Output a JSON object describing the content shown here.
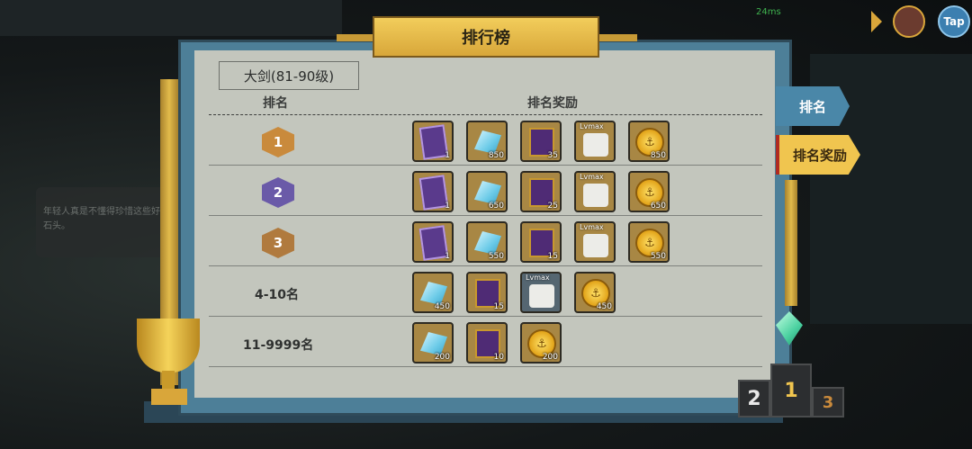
{
  "hud": {
    "ping": "24ms",
    "tap_label": "Tap"
  },
  "npc_bubble": {
    "text": "年轻人真是不懂得珍惜这些好石头。"
  },
  "panel": {
    "title": "排行榜",
    "category": "大剑(81-90级)",
    "col_rank": "排名",
    "col_reward": "排名奖励"
  },
  "tabs": [
    {
      "label": "排名",
      "active": false
    },
    {
      "label": "排名奖励",
      "active": true
    }
  ],
  "rows": [
    {
      "rank": "1",
      "rank_type": "badge",
      "badge_color": "#c98a3c",
      "rewards": [
        {
          "icon": "purple-card-icon",
          "count": "1"
        },
        {
          "icon": "blue-gem-icon",
          "count": "850"
        },
        {
          "icon": "purple-book-icon",
          "count": "35"
        },
        {
          "icon": "lvmax-scroll-icon",
          "label": "Lvmax",
          "count": ""
        },
        {
          "icon": "gold-coin-icon",
          "count": "850"
        }
      ]
    },
    {
      "rank": "2",
      "rank_type": "badge",
      "badge_color": "#6a5aa8",
      "rewards": [
        {
          "icon": "purple-card-icon",
          "count": "1"
        },
        {
          "icon": "blue-gem-icon",
          "count": "650"
        },
        {
          "icon": "purple-book-icon",
          "count": "25"
        },
        {
          "icon": "lvmax-scroll-icon",
          "label": "Lvmax",
          "count": ""
        },
        {
          "icon": "gold-coin-icon",
          "count": "650"
        }
      ]
    },
    {
      "rank": "3",
      "rank_type": "badge",
      "badge_color": "#b07a3e",
      "rewards": [
        {
          "icon": "purple-card-icon",
          "count": "1"
        },
        {
          "icon": "blue-gem-icon",
          "count": "550"
        },
        {
          "icon": "purple-book-icon",
          "count": "15"
        },
        {
          "icon": "lvmax-scroll-icon",
          "label": "Lvmax",
          "count": ""
        },
        {
          "icon": "gold-coin-icon",
          "count": "550"
        }
      ]
    },
    {
      "rank": "4-10名",
      "rank_type": "text",
      "rewards": [
        {
          "icon": "blue-gem-icon",
          "count": "450"
        },
        {
          "icon": "purple-book-icon",
          "count": "15"
        },
        {
          "icon": "lvmax-scroll-icon",
          "label": "Lvmax",
          "count": ""
        },
        {
          "icon": "gold-coin-icon",
          "count": "450"
        }
      ]
    },
    {
      "rank": "11-9999名",
      "rank_type": "text",
      "rewards": [
        {
          "icon": "blue-gem-icon",
          "count": "200"
        },
        {
          "icon": "purple-book-icon",
          "count": "10"
        },
        {
          "icon": "gold-coin-icon",
          "count": "200"
        }
      ]
    }
  ],
  "podium": {
    "left": "2",
    "center": "1",
    "right": "3"
  }
}
